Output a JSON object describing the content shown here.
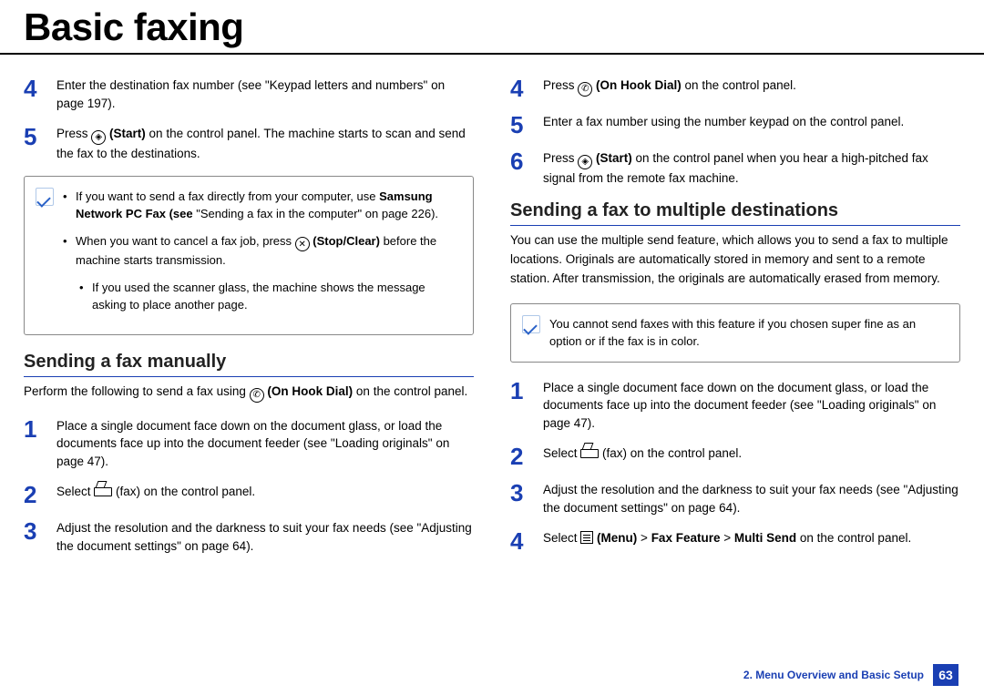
{
  "title": "Basic faxing",
  "left": {
    "step4": {
      "num": "4",
      "pre": "Enter the destination fax number (see \"Keypad letters and numbers\" on page 197)."
    },
    "step5": {
      "num": "5",
      "pre": "Press ",
      "bold": "(Start)",
      "post": " on the control panel. The machine starts to scan and send the fax to the destinations."
    },
    "note": {
      "li1_pre": "If you want to send a fax directly from your computer, use ",
      "li1_bold": "Samsung Network PC Fax (see ",
      "li1_link": "\"Sending a fax in the computer\" on page 226",
      "li1_end": ").",
      "li2_pre": "When you want to cancel a fax job, press ",
      "li2_bold": "(Stop/Clear)",
      "li2_post": " before the machine starts transmission.",
      "li3": "If you used the scanner glass, the machine shows the message asking to place another page."
    },
    "heading": "Sending a fax manually",
    "intro_pre": "Perform the following to send a fax using ",
    "intro_bold": "(On Hook Dial)",
    "intro_post": " on the control panel.",
    "s1": {
      "num": "1",
      "text": "Place a single document face down on the document glass, or load the documents face up into the document feeder (see \"Loading originals\" on page 47)."
    },
    "s2": {
      "num": "2",
      "pre": "Select ",
      "post": "(fax) on the control panel."
    },
    "s3": {
      "num": "3",
      "text": "Adjust the resolution and the darkness to suit your fax needs (see \"Adjusting the document settings\" on page 64)."
    }
  },
  "right": {
    "r4": {
      "num": "4",
      "pre": "Press ",
      "bold": "(On Hook Dial)",
      "post": " on the control panel."
    },
    "r5": {
      "num": "5",
      "text": "Enter a fax number using the number keypad on the control panel."
    },
    "r6": {
      "num": "6",
      "pre": "Press ",
      "bold": "(Start)",
      "post": " on the control panel when you hear a high-pitched fax signal from the remote fax machine."
    },
    "heading": "Sending a fax to multiple destinations",
    "intro": "You can use the multiple send feature, which allows you to send a fax to multiple locations. Originals are automatically stored in memory and sent to a remote station. After transmission, the originals are automatically erased from memory.",
    "note": "You cannot send faxes with this feature if you chosen super fine as an option or if the fax is in color.",
    "m1": {
      "num": "1",
      "text": "Place a single document face down on the document glass, or load the documents face up into the document feeder (see \"Loading originals\" on page 47)."
    },
    "m2": {
      "num": "2",
      "pre": "Select ",
      "post": "(fax) on the control panel."
    },
    "m3": {
      "num": "3",
      "text": "Adjust the resolution and the darkness to suit your fax needs (see \"Adjusting the document settings\" on page 64)."
    },
    "m4": {
      "num": "4",
      "pre": "Select ",
      "bold1": "(Menu)",
      "mid": " > ",
      "bold2": "Fax Feature",
      "mid2": " > ",
      "bold3": "Multi Send",
      "post": " on the control panel."
    }
  },
  "footer": {
    "chapter": "2. Menu Overview and Basic Setup",
    "page": "63"
  }
}
